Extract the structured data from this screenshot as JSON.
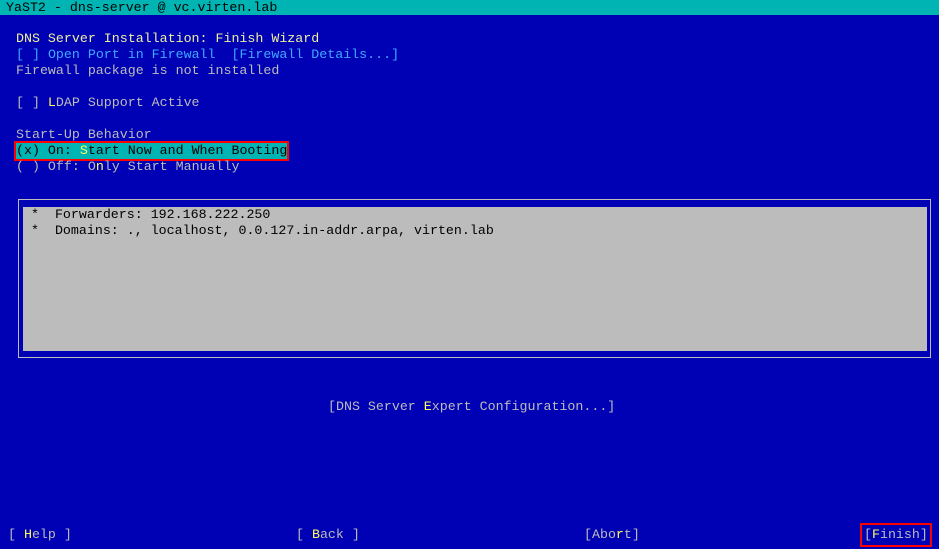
{
  "window": {
    "title": "YaST2 - dns-server @ vc.virten.lab"
  },
  "page": {
    "heading": "DNS Server Installation: Finish Wizard"
  },
  "firewall": {
    "checkbox_box": "[ ]",
    "checkbox_label": "Open Port in Firewall",
    "checked": false,
    "details_button": "[Firewall Details...]",
    "status": "Firewall package is not installed"
  },
  "ldap": {
    "checkbox_box": "[ ] ",
    "hot": "L",
    "rest": "DAP Support Active",
    "checked": false
  },
  "startup": {
    "label": "Start-Up Behavior",
    "options": [
      {
        "box": "(x)",
        "prefix": " On: ",
        "hot": "S",
        "rest": "tart Now and When Booting",
        "selected": true
      },
      {
        "box": "( )",
        "prefix": " Off: O",
        "hot": "n",
        "rest": "ly Start Manually",
        "selected": false
      }
    ]
  },
  "summary": {
    "items": [
      "*  Forwarders: 192.168.222.250",
      "*  Domains: ., localhost, 0.0.127.in-addr.arpa, virten.lab"
    ]
  },
  "expert_button": {
    "pre": "[DNS Server ",
    "hot": "E",
    "post": "xpert Configuration...]"
  },
  "footer": {
    "help": {
      "pre": "[ ",
      "hot": "H",
      "post": "elp ]"
    },
    "back": {
      "pre": "[ ",
      "hot": "B",
      "post": "ack ]"
    },
    "abort": {
      "pre": "[Abo",
      "hot": "r",
      "post": "t]"
    },
    "finish": {
      "pre": "[",
      "hot": "F",
      "post": "inish]"
    }
  },
  "colors": {
    "background": "#0000b4",
    "titlebar": "#00b4b4",
    "highlight": "#00b4b4",
    "hotkey": "#ffff54",
    "focus_outline": "#ff0000",
    "summary_bg": "#bcbcbc"
  }
}
